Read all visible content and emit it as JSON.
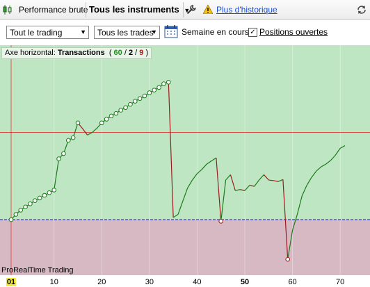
{
  "toolbar": {
    "performance_label": "Performance brute",
    "instruments_label": "Tous les instruments",
    "history_link": "Plus d'historique"
  },
  "filters": {
    "trading_select": "Tout le trading",
    "trades_select": "Tous les trades",
    "week_label": "Semaine en cours",
    "open_positions_label": "Positions ouvertes",
    "open_positions_checked": true
  },
  "chart": {
    "axis_label_prefix": "Axe horizontal:",
    "axis_label_name": "Transactions",
    "count_open": "(",
    "count_win": "60",
    "count_slash1": "/",
    "count_even": "2",
    "count_slash2": "/",
    "count_loss": "9",
    "count_close": ")",
    "brand": "ProRealTime Trading",
    "colors": {
      "gain_bg": "#bfe6c3",
      "loss_bg": "#d6b9c3",
      "up_line": "#1a7a1a",
      "down_line": "#9b1a1a",
      "cursor": "#e03030",
      "zero_line": "#2b3aa8"
    },
    "x_ticks": [
      {
        "label": "01",
        "x": 1,
        "bold": true
      },
      {
        "label": "10",
        "x": 10,
        "bold": false
      },
      {
        "label": "20",
        "x": 20,
        "bold": false
      },
      {
        "label": "30",
        "x": 30,
        "bold": false
      },
      {
        "label": "40",
        "x": 40,
        "bold": false
      },
      {
        "label": "50",
        "x": 50,
        "bold": true
      },
      {
        "label": "60",
        "x": 60,
        "bold": false
      },
      {
        "label": "70",
        "x": 70,
        "bold": false
      }
    ]
  },
  "chart_data": {
    "type": "line",
    "xlabel": "Transactions",
    "xlim": [
      0,
      72
    ],
    "ylim": [
      -10.5,
      33
    ],
    "x": [
      1,
      2,
      3,
      4,
      5,
      6,
      7,
      8,
      9,
      10,
      11,
      12,
      13,
      14,
      15,
      16,
      17,
      18,
      19,
      20,
      21,
      22,
      23,
      24,
      25,
      26,
      27,
      28,
      29,
      30,
      31,
      32,
      33,
      34,
      35,
      36,
      37,
      38,
      39,
      40,
      41,
      42,
      43,
      44,
      45,
      46,
      47,
      48,
      49,
      50,
      51,
      52,
      53,
      54,
      55,
      56,
      57,
      58,
      59,
      60,
      61,
      62,
      63,
      64,
      65,
      66,
      67,
      68,
      69,
      70,
      71
    ],
    "y": [
      0,
      1,
      1.8,
      2.4,
      3,
      3.6,
      4.1,
      4.6,
      5.1,
      5.6,
      11.5,
      12.5,
      15,
      15.5,
      18.3,
      17.2,
      16,
      16.5,
      17.3,
      18.3,
      19,
      19.6,
      20.1,
      20.7,
      21.2,
      21.8,
      22.4,
      22.9,
      23.4,
      24,
      24.5,
      25,
      25.7,
      26,
      0.4,
      1,
      3.5,
      6,
      7.5,
      8.7,
      9.5,
      10.5,
      11.1,
      11.7,
      -0.3,
      7.5,
      8.5,
      5.5,
      5.7,
      5.5,
      6.5,
      6.3,
      7.5,
      8.5,
      7.5,
      7.4,
      7.2,
      7.6,
      -7.5,
      -2,
      1,
      4.5,
      6.5,
      8,
      9.2,
      10,
      10.5,
      11.2,
      12.2,
      13.5,
      14
    ]
  }
}
